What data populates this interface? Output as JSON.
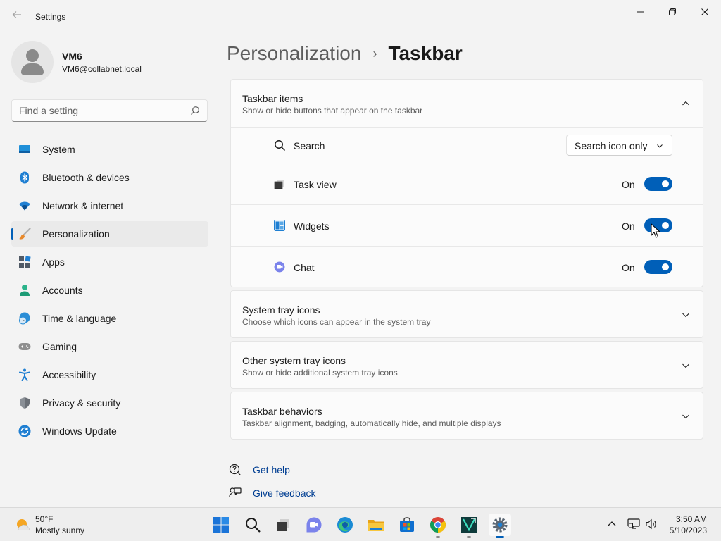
{
  "window": {
    "title": "Settings"
  },
  "profile": {
    "name": "VM6",
    "email": "VM6@collabnet.local"
  },
  "search": {
    "placeholder": "Find a setting"
  },
  "sidebar": {
    "items": [
      {
        "label": "System",
        "icon": "system-icon",
        "active": false
      },
      {
        "label": "Bluetooth & devices",
        "icon": "bluetooth-icon",
        "active": false
      },
      {
        "label": "Network & internet",
        "icon": "wifi-icon",
        "active": false
      },
      {
        "label": "Personalization",
        "icon": "brush-icon",
        "active": true
      },
      {
        "label": "Apps",
        "icon": "apps-icon",
        "active": false
      },
      {
        "label": "Accounts",
        "icon": "accounts-icon",
        "active": false
      },
      {
        "label": "Time & language",
        "icon": "globe-clock-icon",
        "active": false
      },
      {
        "label": "Gaming",
        "icon": "gamepad-icon",
        "active": false
      },
      {
        "label": "Accessibility",
        "icon": "accessibility-icon",
        "active": false
      },
      {
        "label": "Privacy & security",
        "icon": "shield-icon",
        "active": false
      },
      {
        "label": "Windows Update",
        "icon": "update-icon",
        "active": false
      }
    ]
  },
  "breadcrumb": {
    "parent": "Personalization",
    "separator": "›",
    "current": "Taskbar"
  },
  "taskbar_items": {
    "title": "Taskbar items",
    "subtitle": "Show or hide buttons that appear on the taskbar",
    "expanded": true,
    "search": {
      "label": "Search",
      "value": "Search icon only"
    },
    "rows": [
      {
        "label": "Task view",
        "state": "On",
        "on": true,
        "icon": "task-view-icon"
      },
      {
        "label": "Widgets",
        "state": "On",
        "on": true,
        "icon": "widgets-icon"
      },
      {
        "label": "Chat",
        "state": "On",
        "on": true,
        "icon": "chat-icon"
      }
    ]
  },
  "sections": [
    {
      "title": "System tray icons",
      "subtitle": "Choose which icons can appear in the system tray"
    },
    {
      "title": "Other system tray icons",
      "subtitle": "Show or hide additional system tray icons"
    },
    {
      "title": "Taskbar behaviors",
      "subtitle": "Taskbar alignment, badging, automatically hide, and multiple displays"
    }
  ],
  "help": {
    "get_help": "Get help",
    "give_feedback": "Give feedback"
  },
  "taskbar": {
    "weather": {
      "temp": "50°F",
      "desc": "Mostly sunny"
    },
    "apps": [
      "start-icon",
      "search-icon",
      "task-view-icon",
      "teams-chat-icon",
      "edge-icon",
      "file-explorer-icon",
      "store-icon",
      "chrome-icon",
      "terminal-app-icon",
      "settings-icon"
    ],
    "clock": {
      "time": "3:50 AM",
      "date": "5/10/2023"
    }
  },
  "colors": {
    "accent": "#005fb8",
    "background": "#f3f3f3",
    "card": "#fbfbfb"
  }
}
